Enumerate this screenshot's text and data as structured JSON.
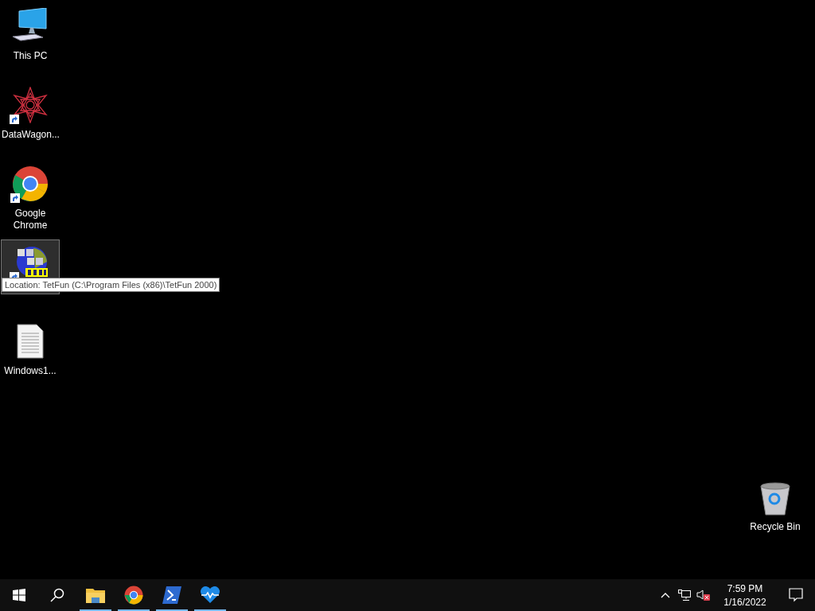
{
  "desktop_icons": [
    {
      "kind": "computer",
      "label": "This PC",
      "shortcut": false,
      "selected": false
    },
    {
      "kind": "star",
      "label": "DataWagon...",
      "shortcut": true,
      "selected": false
    },
    {
      "kind": "chrome",
      "label": "Google Chrome",
      "shortcut": true,
      "selected": false
    },
    {
      "kind": "game",
      "shortcut": true,
      "selected": true
    },
    {
      "kind": "document",
      "label": "Windows1...",
      "shortcut": false,
      "selected": false
    }
  ],
  "tooltip": {
    "text": "Location: TetFun (C:\\Program Files (x86)\\TetFun 2000)"
  },
  "recycle_bin": {
    "label": "Recycle Bin"
  },
  "taskbar": {
    "apps": [
      {
        "kind": "folder",
        "running": true
      },
      {
        "kind": "chrome",
        "running": true
      },
      {
        "kind": "terminal",
        "running": true
      },
      {
        "kind": "heart",
        "running": true
      }
    ],
    "tray": {
      "sound_muted": true,
      "time": "7:59 PM",
      "date": "1/16/2022"
    }
  }
}
